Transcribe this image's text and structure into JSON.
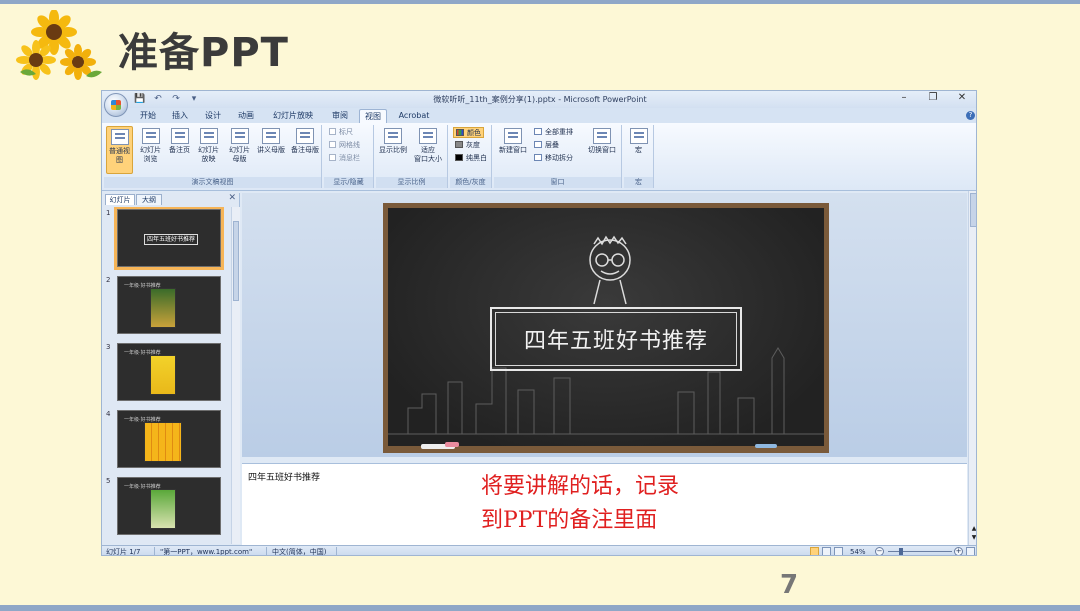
{
  "slide": {
    "title": "准备PPT",
    "page_number": "7"
  },
  "window": {
    "title": "微软听听_11th_案例分享(1).pptx - Microsoft PowerPoint",
    "controls": {
      "minimize": "–",
      "restore": "❐",
      "close": "✕"
    },
    "qat": [
      "💾",
      "↶",
      "↷",
      "▾"
    ]
  },
  "ribbon": {
    "tabs": [
      "开始",
      "插入",
      "设计",
      "动画",
      "幻灯片放映",
      "审阅",
      "视图",
      "Acrobat"
    ],
    "active_tab": "视图",
    "groups": {
      "views": {
        "label": "演示文稿视图",
        "buttons": [
          {
            "label": "普通视图"
          },
          {
            "label": "幻灯片\n浏览"
          },
          {
            "label": "备注页"
          },
          {
            "label": "幻灯片\n放映"
          },
          {
            "label": "幻灯片\n母版"
          },
          {
            "label": "讲义母版"
          },
          {
            "label": "备注母版"
          }
        ]
      },
      "showhide": {
        "label": "显示/隐藏",
        "items": [
          "标尺",
          "网格线",
          "消息栏"
        ]
      },
      "zoom": {
        "label": "显示比例",
        "buttons": [
          {
            "label": "显示比例"
          },
          {
            "label": "适应\n窗口大小"
          }
        ]
      },
      "color": {
        "label": "颜色/灰度",
        "items": [
          "颜色",
          "灰度",
          "纯黑白"
        ]
      },
      "window": {
        "label": "窗口",
        "new_window": "新建窗口",
        "items": [
          "全部重排",
          "层叠",
          "移动拆分"
        ],
        "switch": "切换窗口"
      },
      "macro": {
        "label": "宏",
        "button": "宏"
      }
    }
  },
  "left_panel": {
    "tabs": [
      "幻灯片",
      "大纲"
    ],
    "close": "✕",
    "thumbnails": [
      {
        "num": "1",
        "caption": "四年五班好书推荐"
      },
      {
        "num": "2",
        "header": "一年级·好书推荐"
      },
      {
        "num": "3",
        "header": "一年级·好书推荐"
      },
      {
        "num": "4",
        "header": "一年级·好书推荐"
      },
      {
        "num": "5",
        "header": "一年级·好书推荐"
      }
    ]
  },
  "main_slide": {
    "title": "四年五班好书推荐"
  },
  "notes": {
    "text": "四年五班好书推荐",
    "overlay_line1": "将要讲解的话，记录",
    "overlay_line2": "到PPT的备注里面"
  },
  "statusbar": {
    "slide_info": "幻灯片 1/7",
    "theme": "\"第一PPT，www.1ppt.com\"",
    "language": "中文(简体，中国)",
    "zoom": "54%",
    "zoom_minus": "−",
    "zoom_plus": "+"
  },
  "colors": {
    "page_bg": "#fdf8d6",
    "note_overlay": "#e02020",
    "selection": "#f6b457"
  }
}
